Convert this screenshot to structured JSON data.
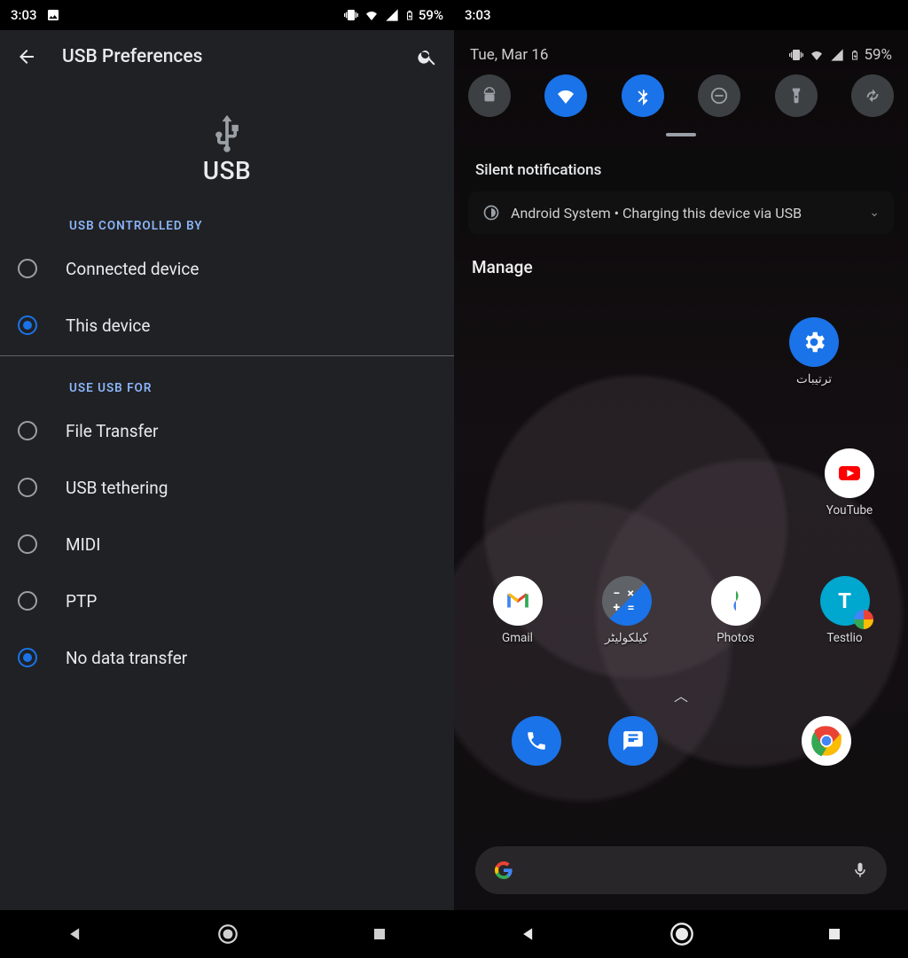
{
  "status": {
    "time": "3:03",
    "battery": "59%"
  },
  "left": {
    "title": "USB Preferences",
    "hero": "USB",
    "section1_label": "USB CONTROLLED BY",
    "controlled": [
      "Connected device",
      "This device"
    ],
    "controlled_selected": 1,
    "section2_label": "USE USB FOR",
    "use_for": [
      "File Transfer",
      "USB tethering",
      "MIDI",
      "PTP",
      "No data transfer"
    ],
    "use_for_selected": 4
  },
  "right": {
    "date": "Tue, Mar 16",
    "qs_tiles": [
      {
        "name": "android-icon",
        "on": false
      },
      {
        "name": "wifi-icon",
        "on": true
      },
      {
        "name": "bluetooth-icon",
        "on": true
      },
      {
        "name": "dnd-icon",
        "on": false
      },
      {
        "name": "flashlight-icon",
        "on": false
      },
      {
        "name": "rotate-icon",
        "on": false
      }
    ],
    "silent_header": "Silent notifications",
    "noti_app": "Android System",
    "noti_text": "Charging this device via USB",
    "manage": "Manage",
    "apps_row1": [
      {
        "label": "ترتیبات",
        "name": "settings"
      }
    ],
    "apps_row2": [
      {
        "label": "YouTube",
        "name": "youtube"
      }
    ],
    "apps_row3": [
      {
        "label": "Gmail",
        "name": "gmail"
      },
      {
        "label": "کیلکولیٹر",
        "name": "calculator"
      },
      {
        "label": "Photos",
        "name": "photos"
      },
      {
        "label": "Testlio",
        "name": "testlio"
      }
    ],
    "dock": [
      {
        "name": "phone"
      },
      {
        "name": "messages"
      },
      {
        "name": "chrome"
      }
    ]
  }
}
